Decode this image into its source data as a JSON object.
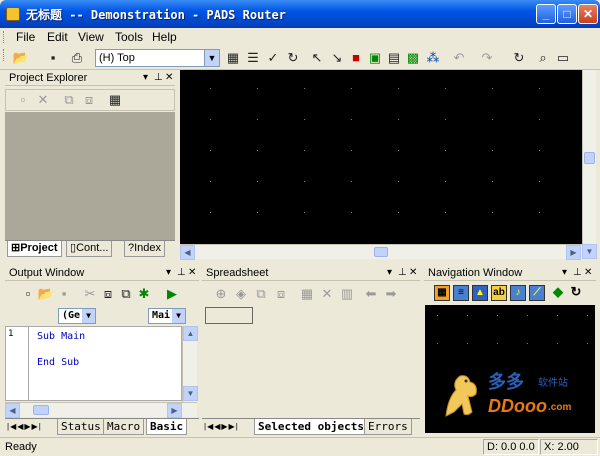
{
  "window": {
    "title": "无标题 -- Demonstration - PADS Router"
  },
  "menu": [
    "File",
    "Edit",
    "View",
    "Tools",
    "Help"
  ],
  "toolbar": {
    "layer_value": "(H) Top"
  },
  "project_explorer": {
    "title": "Project Explorer",
    "tabs": [
      "Project",
      "Cont...",
      "Index"
    ]
  },
  "output_window": {
    "title": "Output Window",
    "combo_left": "(Ge",
    "combo_right": "Mai",
    "line_number": "1",
    "code": [
      "Sub Main",
      "",
      "End Sub"
    ],
    "tabs": [
      "Status",
      "Macro",
      "Basic"
    ]
  },
  "spreadsheet": {
    "title": "Spreadsheet",
    "tabs": [
      "Selected objects",
      "Errors"
    ]
  },
  "navigation": {
    "title": "Navigation Window",
    "watermark_cn": "多多",
    "watermark_cn2": "软件站",
    "watermark_en": "DDooo",
    "watermark_en2": ".com"
  },
  "status": {
    "ready": "Ready",
    "d_readout": "D: 0.0 0.0",
    "x_readout": "X:  2.00"
  },
  "colors": {
    "titlebar": "#0055e5",
    "canvas": "#000000",
    "chrome": "#ece9d8"
  }
}
